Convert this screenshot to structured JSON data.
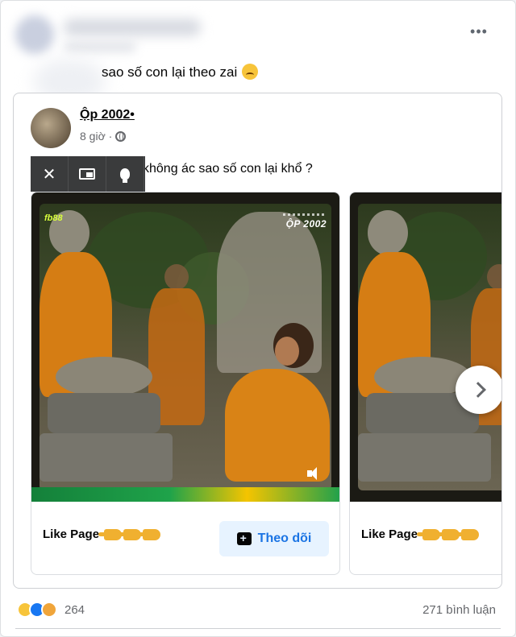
{
  "post": {
    "more_label": "•••",
    "caption": "sao số con lại theo zai"
  },
  "shared_post": {
    "page_name": "Ộp 2002•",
    "time": "8 giờ ·",
    "text": "không ác sao số con lại khổ ?"
  },
  "toolbar": {
    "close_label": "✕"
  },
  "carousel": {
    "card1": {
      "watermark_left": "fb88",
      "watermark_right": "ỘP 2002",
      "like_page": "Like Page",
      "follow_label": "Theo dõi"
    },
    "card2": {
      "like_page": "Like Page"
    }
  },
  "footer": {
    "reaction_count": "264",
    "comment_count": "271 bình luận"
  },
  "colors": {
    "accent": "#1b74e4",
    "follow_bg": "#e7f3ff",
    "robe": "#d57d14"
  }
}
